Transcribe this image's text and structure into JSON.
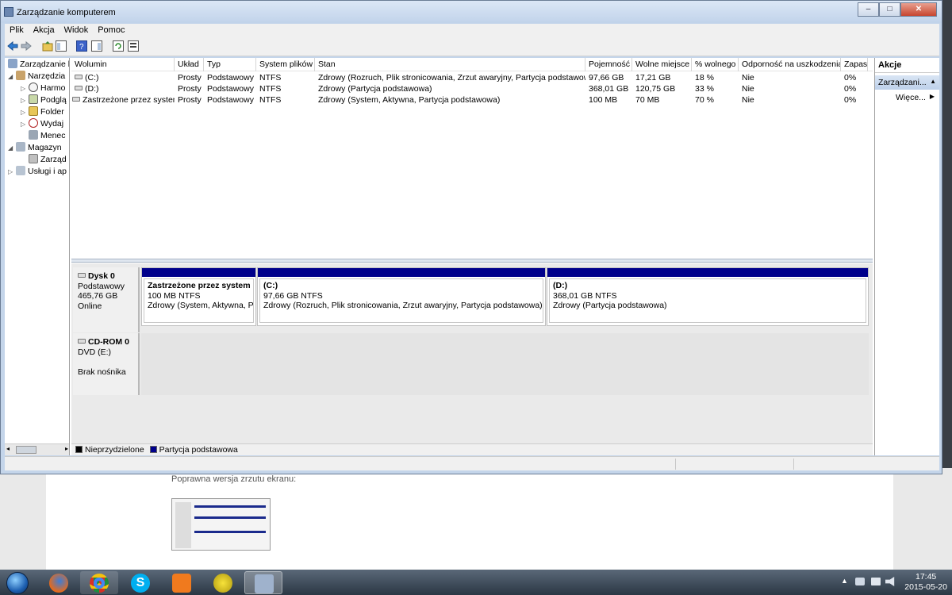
{
  "window": {
    "title": "Zarządzanie komputerem",
    "min": "–",
    "max": "□",
    "close": "✕"
  },
  "menu": [
    "Plik",
    "Akcja",
    "Widok",
    "Pomoc"
  ],
  "tree": [
    {
      "label": "Zarządzanie k",
      "expander": "",
      "icon": "computer-management-icon"
    },
    {
      "label": "Narzędzia",
      "expander": "◢",
      "icon": "tools-icon"
    },
    {
      "label": "Harmo",
      "expander": "▷",
      "icon": "task-scheduler-icon"
    },
    {
      "label": "Podglą",
      "expander": "▷",
      "icon": "event-viewer-icon"
    },
    {
      "label": "Folder",
      "expander": "▷",
      "icon": "shared-folders-icon"
    },
    {
      "label": "Wydaj",
      "expander": "▷",
      "icon": "performance-icon"
    },
    {
      "label": "Menec",
      "expander": "",
      "icon": "device-manager-icon"
    },
    {
      "label": "Magazyn",
      "expander": "◢",
      "icon": "storage-icon"
    },
    {
      "label": "Zarząd",
      "expander": "",
      "icon": "disk-management-icon"
    },
    {
      "label": "Usługi i ap",
      "expander": "▷",
      "icon": "services-icon"
    }
  ],
  "volumes": {
    "headers": [
      "Wolumin",
      "Układ",
      "Typ",
      "System plików",
      "Stan",
      "Pojemność",
      "Wolne miejsce",
      "% wolnego",
      "Odporność na uszkodzenia",
      "Zapas"
    ],
    "rows": [
      [
        "(C:)",
        "Prosty",
        "Podstawowy",
        "NTFS",
        "Zdrowy (Rozruch, Plik stronicowania, Zrzut awaryjny, Partycja podstawowa)",
        "97,66 GB",
        "17,21 GB",
        "18 %",
        "Nie",
        "0%"
      ],
      [
        "(D:)",
        "Prosty",
        "Podstawowy",
        "NTFS",
        "Zdrowy (Partycja podstawowa)",
        "368,01 GB",
        "120,75 GB",
        "33 %",
        "Nie",
        "0%"
      ],
      [
        "Zastrzeżone przez system",
        "Prosty",
        "Podstawowy",
        "NTFS",
        "Zdrowy (System, Aktywna, Partycja podstawowa)",
        "100 MB",
        "70 MB",
        "70 %",
        "Nie",
        "0%"
      ]
    ]
  },
  "disks": [
    {
      "name": "Dysk 0",
      "type": "Podstawowy",
      "size": "465,76 GB",
      "status": "Online",
      "partitions": [
        {
          "title": "Zastrzeżone przez system",
          "size": "100 MB NTFS",
          "state": "Zdrowy (System, Aktywna, Par"
        },
        {
          "title": "(C:)",
          "size": "97,66 GB NTFS",
          "state": "Zdrowy (Rozruch, Plik stronicowania, Zrzut awaryjny, Partycja podstawowa)"
        },
        {
          "title": "(D:)",
          "size": "368,01 GB NTFS",
          "state": "Zdrowy (Partycja podstawowa)"
        }
      ]
    },
    {
      "name": "CD-ROM 0",
      "type": "DVD (E:)",
      "size": "",
      "status": "Brak nośnika"
    }
  ],
  "legend": {
    "unallocated": "Nieprzydzielone",
    "primary": "Partycja podstawowa",
    "unallocated_color": "#000000",
    "primary_color": "#00008b"
  },
  "actions": {
    "title": "Akcje",
    "selected": "Zarządzani...",
    "more": "Więce..."
  },
  "background": {
    "caption": "Poprawna wersja zrzutu ekranu:"
  },
  "taskbar": {
    "time": "17:45",
    "date": "2015-05-20",
    "lang": "▲"
  }
}
